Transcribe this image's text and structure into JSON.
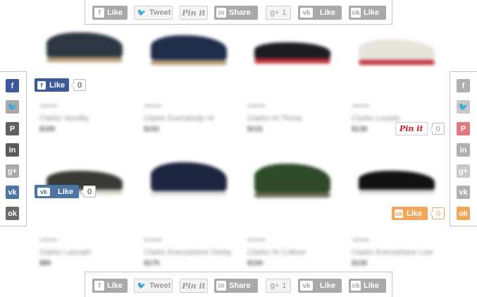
{
  "colors": {
    "facebook": "#3b5998",
    "twitter": "#a9a9a9",
    "pinterest": "#cb2027",
    "vk": "#4c75a3",
    "odnoklassniki": "#ee8208",
    "inactive": "#a9a9a9"
  },
  "products": [
    {
      "name": "Clarks Vendity",
      "price": "$180",
      "shoe_color": "#2d3642",
      "sole_color": "#b59a77"
    },
    {
      "name": "Clarks Everybody Hi",
      "price": "$152",
      "shoe_color": "#1f2d4a",
      "sole_color": "#b59a77"
    },
    {
      "name": "Clarks Hi Thrive",
      "price": "$115",
      "shoe_color": "#1c1c22",
      "sole_color": "#c0303a"
    },
    {
      "name": "Clarks Lunatic",
      "price": "$139",
      "shoe_color": "#e8e3dc",
      "sole_color": "#c0303a"
    },
    {
      "name": "Clarks Lannalo",
      "price": "$80",
      "shoe_color": "#3a3a35",
      "sole_color": "#d6d2c8"
    },
    {
      "name": "Clarks Everywhere Derby",
      "price": "$175",
      "shoe_color": "#1e2540",
      "sole_color": "#e5e2dd"
    },
    {
      "name": "Clarks Hi Culture",
      "price": "$150",
      "shoe_color": "#2e4a2a",
      "sole_color": "#6f6a5a"
    },
    {
      "name": "Clarks Everywhere Low",
      "price": "$135",
      "shoe_color": "#121212",
      "sole_color": "#e0e0e0"
    }
  ],
  "share_bar": {
    "facebook": "Like",
    "twitter": "Tweet",
    "pinterest": "Pin it",
    "linkedin": "Share",
    "googleplus": "1",
    "vk": "Like",
    "odnoklassniki": "Like"
  },
  "floating": {
    "facebook": {
      "label": "Like",
      "count": "0"
    },
    "vk": {
      "label": "Like",
      "count": "0"
    },
    "pinterest": {
      "label": "Pin it",
      "count": "0"
    },
    "odnoklassniki": {
      "label": "Like",
      "count": "0"
    }
  },
  "icons": {
    "facebook": "f",
    "twitter": "🐦",
    "pinterest": "P",
    "linkedin": "in",
    "googleplus": "g+",
    "vk": "vk",
    "odnoklassniki": "ok"
  },
  "sidebar_networks": [
    "facebook",
    "twitter",
    "pinterest",
    "linkedin",
    "googleplus",
    "vk",
    "odnoklassniki"
  ]
}
